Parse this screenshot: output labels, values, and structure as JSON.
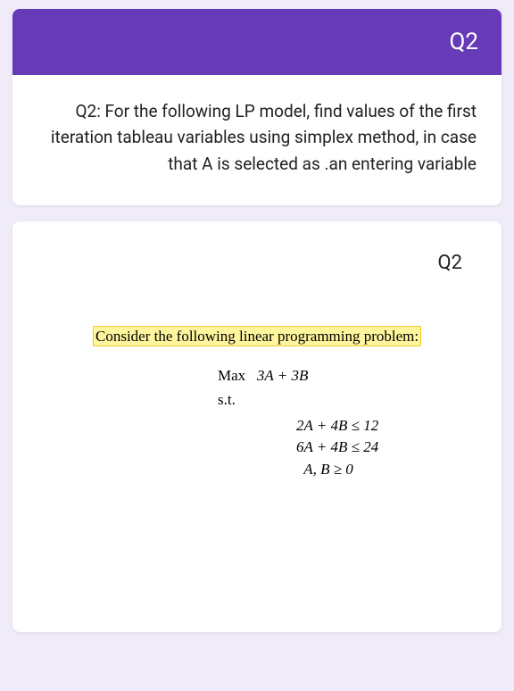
{
  "header": {
    "title": "Q2"
  },
  "question": {
    "text": "Q2: For the following LP model, find values of the first iteration tableau variables using simplex method, in case that A is selected as .an entering variable"
  },
  "content": {
    "label": "Q2",
    "problem_intro": "Consider the following linear programming problem:",
    "lp": {
      "objective_label": "Max",
      "objective_expr": "3A + 3B",
      "st_label": "s.t.",
      "constraint1": "2A + 4B ≤ 12",
      "constraint2": "6A + 4B ≤ 24",
      "nonneg": "A, B ≥ 0"
    }
  }
}
